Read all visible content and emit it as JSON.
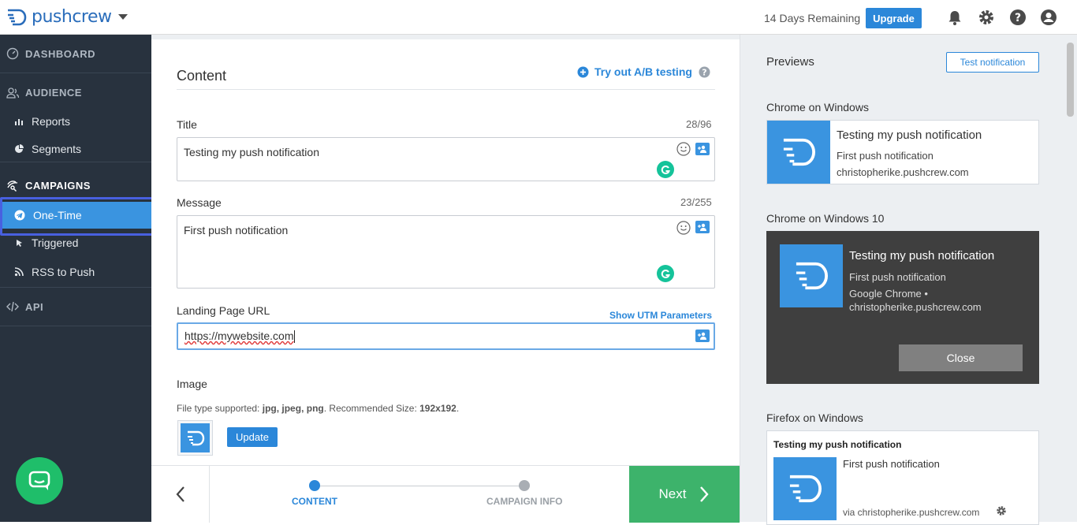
{
  "brand": {
    "name": "pushcrew"
  },
  "topbar": {
    "days_remaining": "14 Days Remaining",
    "upgrade_label": "Upgrade"
  },
  "sidebar": {
    "dashboard": "DASHBOARD",
    "audience": "AUDIENCE",
    "reports": "Reports",
    "segments": "Segments",
    "campaigns": "CAMPAIGNS",
    "one_time": "One-Time",
    "triggered": "Triggered",
    "rss": "RSS to Push",
    "api": "API"
  },
  "content": {
    "heading": "Content",
    "ab_testing": "Try out A/B testing",
    "title_label": "Title",
    "title_count": "28/96",
    "title_value": "Testing my push notification",
    "message_label": "Message",
    "message_count": "23/255",
    "message_value": "First push notification",
    "url_label": "Landing Page URL",
    "utm_label": "Show UTM Parameters",
    "url_value": "https://mywebsite.com",
    "image_label": "Image",
    "hint_prefix": "File type supported: ",
    "hint_types": "jpg, jpeg, png",
    "hint_mid": ". Recommended Size: ",
    "hint_size": "192x192",
    "hint_end": ".",
    "update_label": "Update"
  },
  "footer": {
    "step1": "CONTENT",
    "step2": "CAMPAIGN INFO",
    "next": "Next"
  },
  "previews": {
    "heading": "Previews",
    "test_button": "Test notification",
    "chrome_win": {
      "name": "Chrome on Windows",
      "title": "Testing my push notification",
      "message": "First push notification",
      "domain": "christopherike.pushcrew.com"
    },
    "chrome_win10": {
      "name": "Chrome on Windows 10",
      "title": "Testing my push notification",
      "message": "First push notification",
      "source": "Google Chrome •",
      "domain": "christopherike.pushcrew.com",
      "close": "Close"
    },
    "firefox_win": {
      "name": "Firefox on Windows",
      "title": "Testing my push notification",
      "message": "First push notification",
      "domain": "via christopherike.pushcrew.com"
    }
  },
  "colors": {
    "accent": "#2b87d9",
    "sidebar": "#28323e",
    "next": "#3db36b",
    "highlight": "#4860e0"
  }
}
